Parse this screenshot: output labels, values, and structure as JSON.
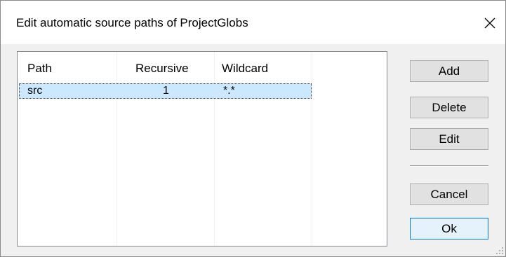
{
  "window": {
    "title": "Edit automatic source paths of ProjectGlobs",
    "close_icon": "close-icon"
  },
  "list": {
    "columns": [
      "Path",
      "Recursive",
      "Wildcard"
    ],
    "rows": [
      {
        "path": "src",
        "recursive": "1",
        "wildcard": "*.*",
        "selected": true
      }
    ]
  },
  "buttons": {
    "add": "Add",
    "delete": "Delete",
    "edit": "Edit",
    "cancel": "Cancel",
    "ok": "Ok"
  },
  "colors": {
    "selection": "#cce8ff",
    "default_button_border": "#0078d7"
  }
}
